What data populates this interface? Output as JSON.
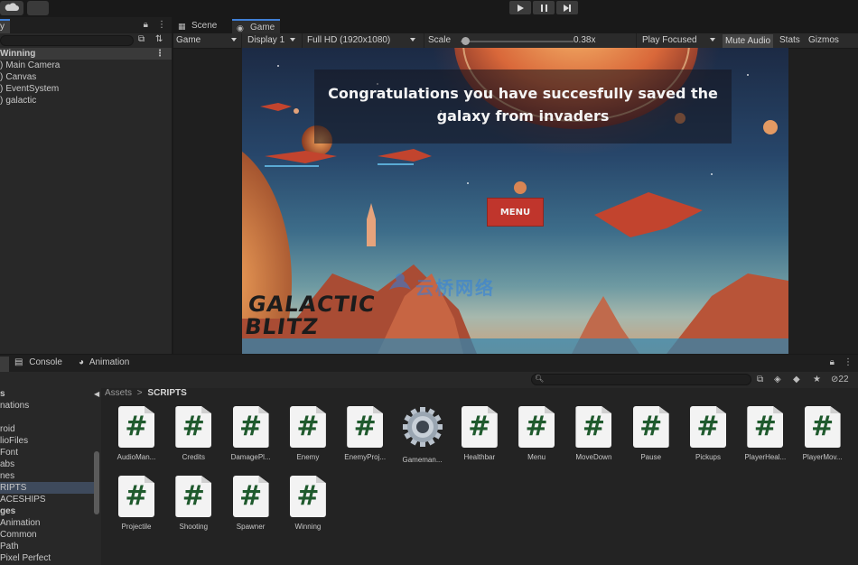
{
  "toolbar": {
    "cloud_icon": "cloud-icon",
    "play_icon": "play-icon",
    "pause_icon": "pause-icon",
    "step_icon": "step-icon"
  },
  "hierarchy": {
    "tab_label": "y",
    "scene_name": "Winning",
    "items": [
      "Main Camera",
      "Canvas",
      "EventSystem",
      "galactic"
    ]
  },
  "game_panel": {
    "tabs": [
      {
        "label": "Scene",
        "icon": "scene-icon"
      },
      {
        "label": "Game",
        "icon": "game-icon"
      }
    ],
    "controls": {
      "view_mode": "Game",
      "display": "Display 1",
      "resolution": "Full HD (1920x1080)",
      "scale_label": "Scale",
      "scale_value": "0.38x",
      "scale_fraction": 0.05,
      "play_mode": "Play Focused",
      "mute_audio": "Mute Audio",
      "stats": "Stats",
      "gizmos": "Gizmos"
    },
    "game_view": {
      "message": "Congratulations you have succesfully saved the galaxy from invaders",
      "menu_button": "MENU",
      "logo_text_line1": "GALACTIC",
      "logo_text_line2": "BLITZ",
      "watermark_text": "云桥网络"
    }
  },
  "bottom_panel": {
    "tabs": [
      {
        "label": "Console",
        "icon": "console-icon"
      },
      {
        "label": "Animation",
        "icon": "animation-icon"
      }
    ],
    "hidden_count": "22",
    "folder_tree": [
      {
        "label": "s",
        "bold": true
      },
      {
        "label": "nations",
        "bold": false
      },
      {
        "label": "",
        "bold": false
      },
      {
        "label": "roid",
        "bold": false
      },
      {
        "label": "lioFiles",
        "bold": false
      },
      {
        "label": "Font",
        "bold": false
      },
      {
        "label": "abs",
        "bold": false
      },
      {
        "label": "nes",
        "bold": false
      },
      {
        "label": "RIPTS",
        "bold": false,
        "selected": true
      },
      {
        "label": "ACESHIPS",
        "bold": false
      },
      {
        "label": "ges",
        "bold": true
      },
      {
        "label": "Animation",
        "bold": false
      },
      {
        "label": "Common",
        "bold": false
      },
      {
        "label": "Path",
        "bold": false
      },
      {
        "label": "Pixel Perfect",
        "bold": false
      }
    ],
    "breadcrumb": {
      "root": "Assets",
      "separator": ">",
      "current": "SCRIPTS"
    },
    "files": [
      {
        "name": "AudioMan...",
        "type": "script"
      },
      {
        "name": "Credits",
        "type": "script"
      },
      {
        "name": "DamagePl...",
        "type": "script"
      },
      {
        "name": "Enemy",
        "type": "script"
      },
      {
        "name": "EnemyProj...",
        "type": "script"
      },
      {
        "name": "Gameman...",
        "type": "gear"
      },
      {
        "name": "Healthbar",
        "type": "script"
      },
      {
        "name": "Menu",
        "type": "script"
      },
      {
        "name": "MoveDown",
        "type": "script"
      },
      {
        "name": "Pause",
        "type": "script"
      },
      {
        "name": "Pickups",
        "type": "script"
      },
      {
        "name": "PlayerHeal...",
        "type": "script"
      },
      {
        "name": "PlayerMov...",
        "type": "script"
      },
      {
        "name": "Projectile",
        "type": "script"
      },
      {
        "name": "Shooting",
        "type": "script"
      },
      {
        "name": "Spawner",
        "type": "script"
      },
      {
        "name": "Winning",
        "type": "script"
      }
    ],
    "script_glyph": "#"
  }
}
